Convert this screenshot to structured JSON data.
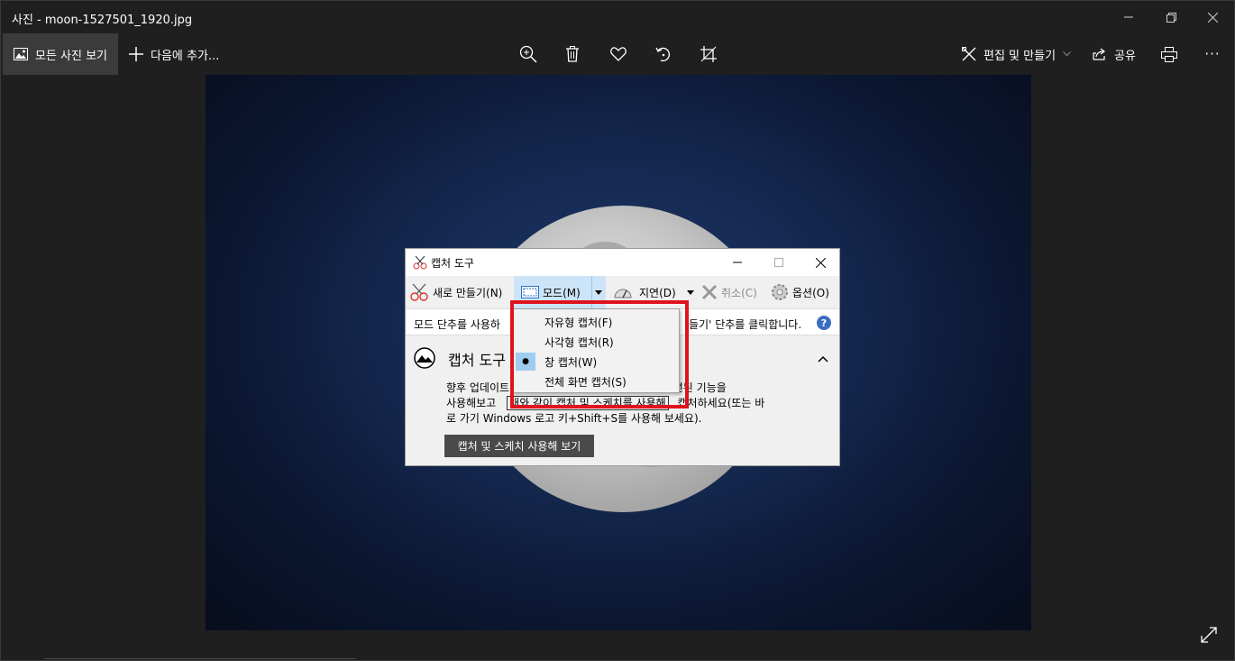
{
  "window": {
    "title": "사진 - moon-1527501_1920.jpg"
  },
  "toolbar": {
    "all_photos": "모든 사진 보기",
    "add_to": "다음에 추가...",
    "edit_create": "편집 및 만들기",
    "share": "공유",
    "more": "···"
  },
  "snip": {
    "title": "캡처 도구",
    "new": "새로 만들기(N)",
    "mode": "모드(M)",
    "delay": "지연(D)",
    "cancel": "취소(C)",
    "options": "옵션(O)",
    "info_left": "모드 단추를 사용하",
    "info_right": "들기' 단추를 클릭합니다.",
    "help": "?",
    "promo_title": "캡처 도구",
    "promo_line1_a": "향후 업데이트",
    "promo_line1_b": "다. 개선된 기능을",
    "promo_line2_a": "사용해보고",
    "promo_line2_b": "래와 같이 캡처 및 스케치를 사용해",
    "promo_line2_c": "캡처하세요(또는 바",
    "promo_line3": "로 가기 Windows 로고 키+Shift+S를 사용해 보세요).",
    "promo_button": "캡처 및 스케치 사용해 보기"
  },
  "menu": {
    "items": [
      "자유형 캡처(F)",
      "사각형 캡처(R)",
      "창 캡처(W)",
      "전체 화면 캡처(S)"
    ],
    "selected_index": 2
  },
  "colors": {
    "highlight": "#e0121d",
    "accent": "#3b6ec3"
  }
}
